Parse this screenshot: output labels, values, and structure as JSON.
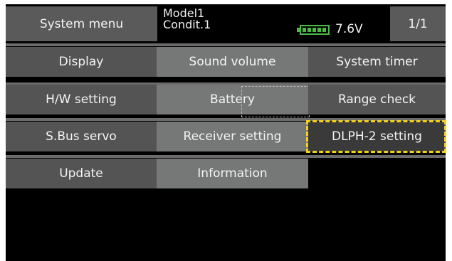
{
  "header": {
    "title": "System menu",
    "model_name": "Model1",
    "condition": "Condit.1",
    "voltage": "7.6V",
    "page": "1/1"
  },
  "menu": {
    "display": "Display",
    "sound_volume": "Sound volume",
    "system_timer": "System timer",
    "hw_setting": "H/W setting",
    "battery": "Battery",
    "range_check": "Range check",
    "sbus_servo": "S.Bus servo",
    "receiver_setting": "Receiver setting",
    "dlph2_setting": "DLPH-2 setting",
    "update": "Update",
    "information": "Information"
  },
  "colors": {
    "highlight": "#f2d21b",
    "battery": "#4db848"
  }
}
